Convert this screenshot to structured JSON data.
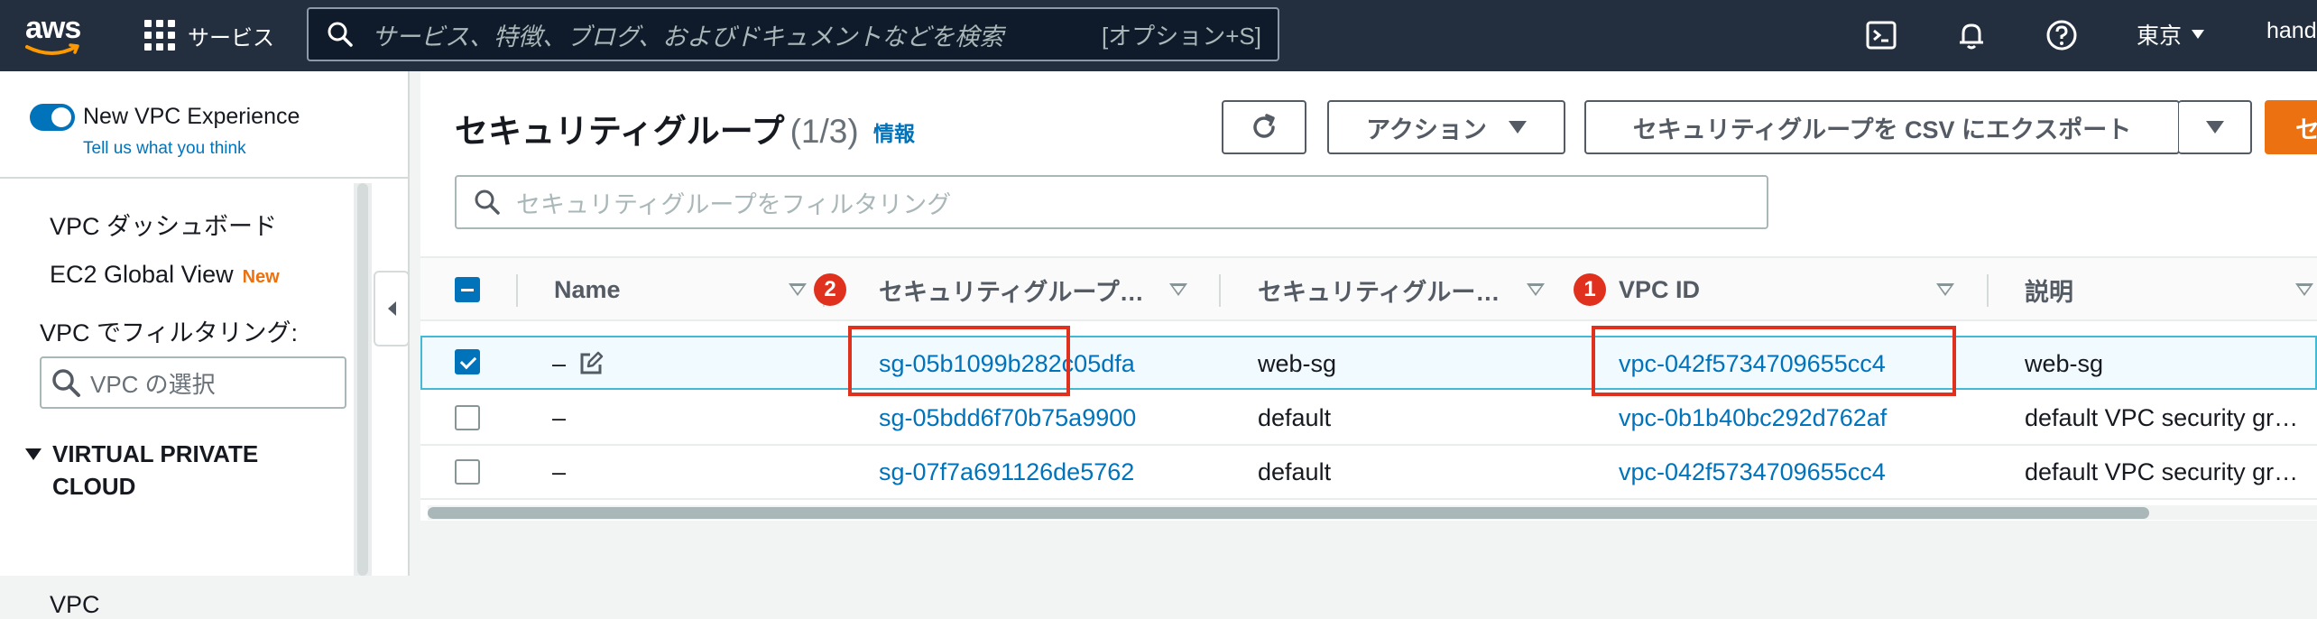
{
  "topbar": {
    "logo": "aws",
    "services_label": "サービス",
    "search_placeholder": "サービス、特徴、ブログ、およびドキュメントなどを検索",
    "search_shortcut": "[オプション+S]",
    "region": "東京",
    "user": "hand"
  },
  "sidebar": {
    "new_vpc_label": "New VPC Experience",
    "tell_us": "Tell us what you think",
    "items": [
      {
        "label": "VPC ダッシュボード"
      },
      {
        "label": "EC2 Global View",
        "tag": "New"
      }
    ],
    "filter_label": "VPC でフィルタリング:",
    "vpc_select_placeholder": "VPC の選択",
    "section_title": "VIRTUAL PRIVATE CLOUD",
    "section_items": [
      {
        "label": "VPC"
      }
    ]
  },
  "main": {
    "title": "セキュリティグループ",
    "count": "(1/3)",
    "info": "情報",
    "actions_label": "アクション",
    "export_label": "セキュリティグループを CSV にエクスポート",
    "create_label": "セ",
    "filter_placeholder": "セキュリティグループをフィルタリング"
  },
  "table": {
    "columns": [
      "Name",
      "セキュリティグループ…",
      "セキュリティグルー…",
      "VPC ID",
      "説明"
    ],
    "rows": [
      {
        "selected": true,
        "name": "–",
        "sg_id": "sg-05b1099b282c05dfa",
        "sg_name": "web-sg",
        "vpc_id": "vpc-042f5734709655cc4",
        "desc": "web-sg"
      },
      {
        "selected": false,
        "name": "–",
        "sg_id": "sg-05bdd6f70b75a9900",
        "sg_name": "default",
        "vpc_id": "vpc-0b1b40bc292d762af",
        "desc": "default VPC security gr…"
      },
      {
        "selected": false,
        "name": "–",
        "sg_id": "sg-07f7a691126de5762",
        "sg_name": "default",
        "vpc_id": "vpc-042f5734709655cc4",
        "desc": "default VPC security gr…"
      }
    ]
  },
  "annotations": {
    "badge_1": "1",
    "badge_2": "2"
  },
  "colors": {
    "accent": "#0073bb",
    "annotation_red": "#e0301e",
    "primary_orange": "#ec7211",
    "topbar": "#232f3e"
  }
}
